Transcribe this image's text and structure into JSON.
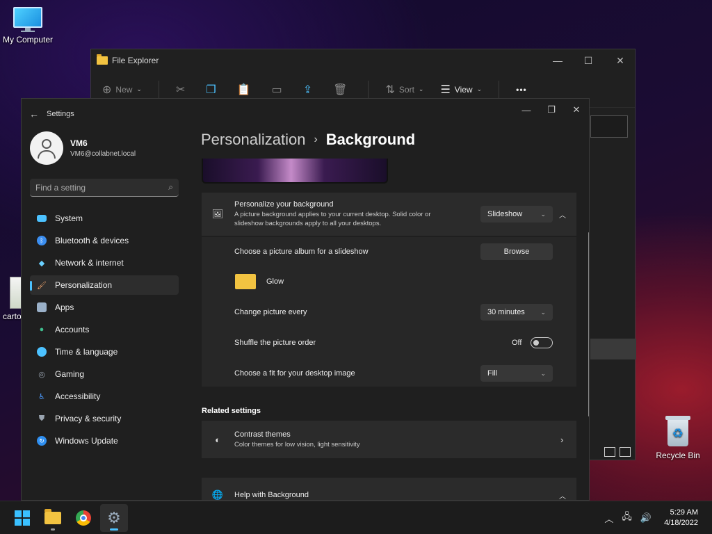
{
  "desktop": {
    "icons": [
      {
        "label": "My Computer"
      },
      {
        "label": "Recycle Bin"
      },
      {
        "label": "carto"
      }
    ]
  },
  "file_explorer": {
    "title": "File Explorer",
    "toolbar": {
      "new_label": "New",
      "sort_label": "Sort",
      "view_label": "View",
      "more_label": "•••"
    }
  },
  "settings": {
    "title": "Settings",
    "user": {
      "name": "VM6",
      "email": "VM6@collabnet.local"
    },
    "search_placeholder": "Find a setting",
    "nav": [
      {
        "label": "System",
        "color": "#4cc2ff"
      },
      {
        "label": "Bluetooth & devices",
        "color": "#3b8ef0"
      },
      {
        "label": "Network & internet",
        "color": "#6ad0ff"
      },
      {
        "label": "Personalization",
        "color": "#e8a06a"
      },
      {
        "label": "Apps",
        "color": "#9ab0c8"
      },
      {
        "label": "Accounts",
        "color": "#3fbf8f"
      },
      {
        "label": "Time & language",
        "color": "#4cc2ff"
      },
      {
        "label": "Gaming",
        "color": "#9aa4b0"
      },
      {
        "label": "Accessibility",
        "color": "#4c9bff"
      },
      {
        "label": "Privacy & security",
        "color": "#9aa4b0"
      },
      {
        "label": "Windows Update",
        "color": "#2f8ff0"
      }
    ],
    "breadcrumb": {
      "parent": "Personalization",
      "separator": "›",
      "current": "Background"
    },
    "personalize": {
      "title": "Personalize your background",
      "subtitle": "A picture background applies to your current desktop. Solid color or slideshow backgrounds apply to all your desktops.",
      "value": "Slideshow"
    },
    "album": {
      "label": "Choose a picture album for a slideshow",
      "button": "Browse",
      "folder": "Glow"
    },
    "change_every": {
      "label": "Change picture every",
      "value": "30 minutes"
    },
    "shuffle": {
      "label": "Shuffle the picture order",
      "state": "Off"
    },
    "fit": {
      "label": "Choose a fit for your desktop image",
      "value": "Fill"
    },
    "related_title": "Related settings",
    "contrast": {
      "title": "Contrast themes",
      "subtitle": "Color themes for low vision, light sensitivity"
    },
    "help": {
      "title": "Help with Background"
    }
  },
  "taskbar": {
    "time": "5:29 AM",
    "date": "4/18/2022"
  }
}
